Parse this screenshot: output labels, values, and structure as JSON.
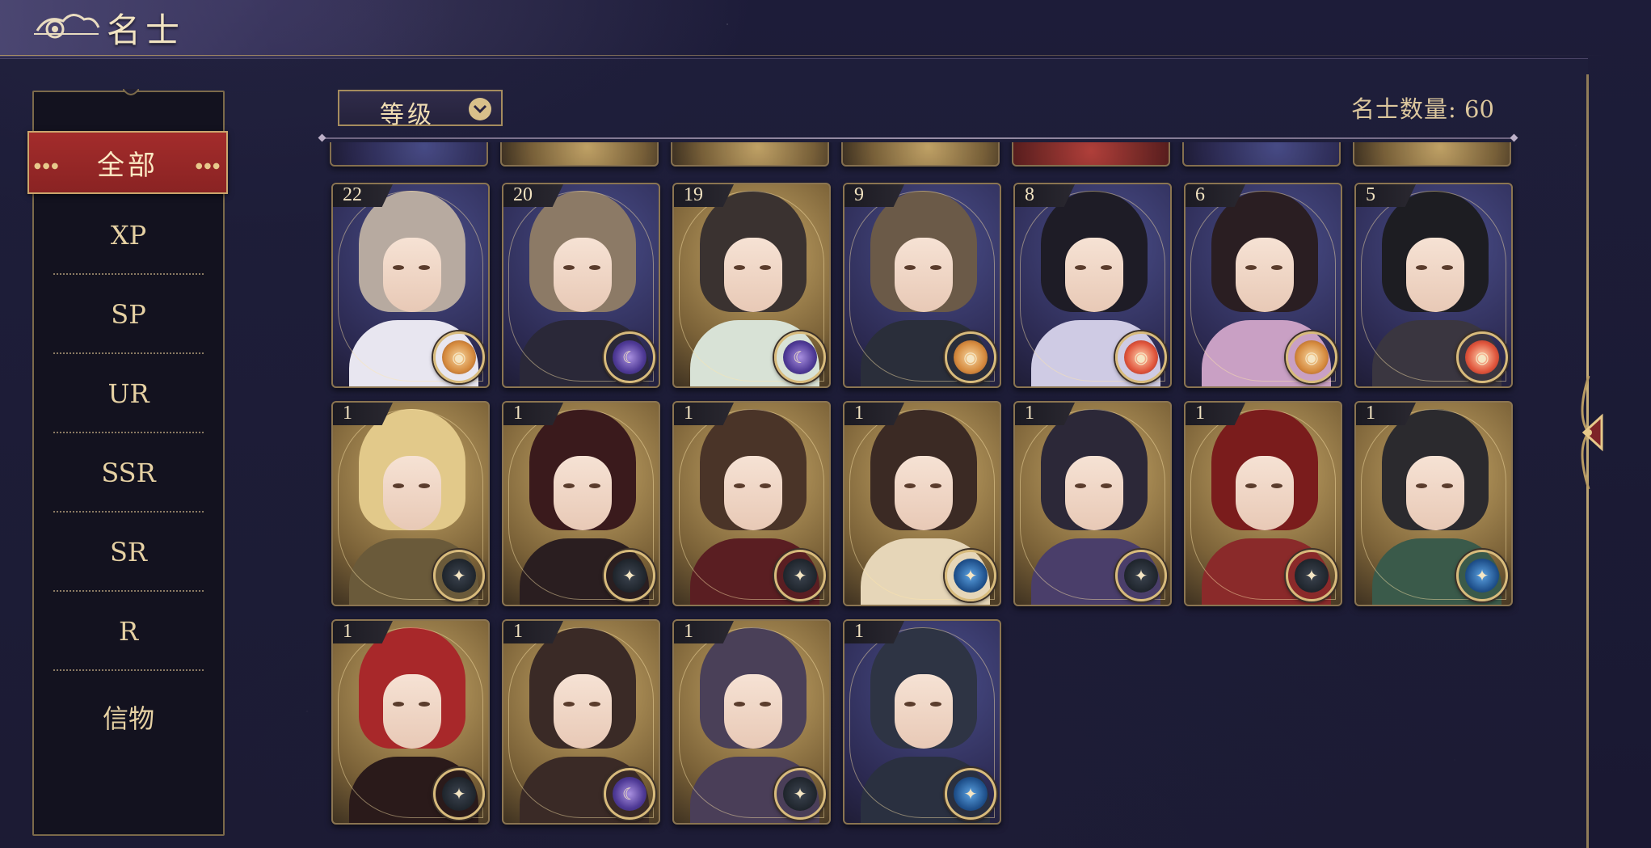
{
  "header": {
    "title": "名士",
    "back_icon": "cloud-swirl-back-icon"
  },
  "sidebar": {
    "active": "全部",
    "items": [
      "XP",
      "SP",
      "UR",
      "SSR",
      "SR",
      "R",
      "信物"
    ]
  },
  "toolbar": {
    "sort_label": "等级",
    "sort_icon": "chevron-down-icon",
    "count_label": "名士数量:",
    "count_value": "60"
  },
  "colors": {
    "accent_red": "#a32c2b",
    "gold": "#caa56c",
    "panel": "#13121f"
  },
  "cards": [
    {
      "level": "22",
      "badge": "sun-element-icon",
      "bg": "purple"
    },
    {
      "level": "20",
      "badge": "moon-star-element-icon",
      "bg": "purple"
    },
    {
      "level": "19",
      "badge": "moon-star-element-icon",
      "bg": "gold"
    },
    {
      "level": "9",
      "badge": "sun-element-icon",
      "bg": "purple"
    },
    {
      "level": "8",
      "badge": "sun-red-element-icon",
      "bg": "purple"
    },
    {
      "level": "6",
      "badge": "sun-element-icon",
      "bg": "purple"
    },
    {
      "level": "5",
      "badge": "sun-red-element-icon",
      "bg": "purple"
    },
    {
      "level": "1",
      "badge": "compass-element-icon",
      "bg": "gold"
    },
    {
      "level": "1",
      "badge": "compass-element-icon",
      "bg": "gold"
    },
    {
      "level": "1",
      "badge": "compass-element-icon",
      "bg": "gold"
    },
    {
      "level": "1",
      "badge": "blue-compass-element-icon",
      "bg": "gold"
    },
    {
      "level": "1",
      "badge": "compass-element-icon",
      "bg": "gold"
    },
    {
      "level": "1",
      "badge": "compass-element-icon",
      "bg": "gold"
    },
    {
      "level": "1",
      "badge": "blue-compass-element-icon",
      "bg": "gold"
    },
    {
      "level": "1",
      "badge": "compass-element-icon",
      "bg": "gold"
    },
    {
      "level": "1",
      "badge": "moon-star-element-icon",
      "bg": "gold"
    },
    {
      "level": "1",
      "badge": "compass-element-icon",
      "bg": "gold"
    },
    {
      "level": "1",
      "badge": "blue-compass-element-icon",
      "bg": "purple"
    }
  ]
}
